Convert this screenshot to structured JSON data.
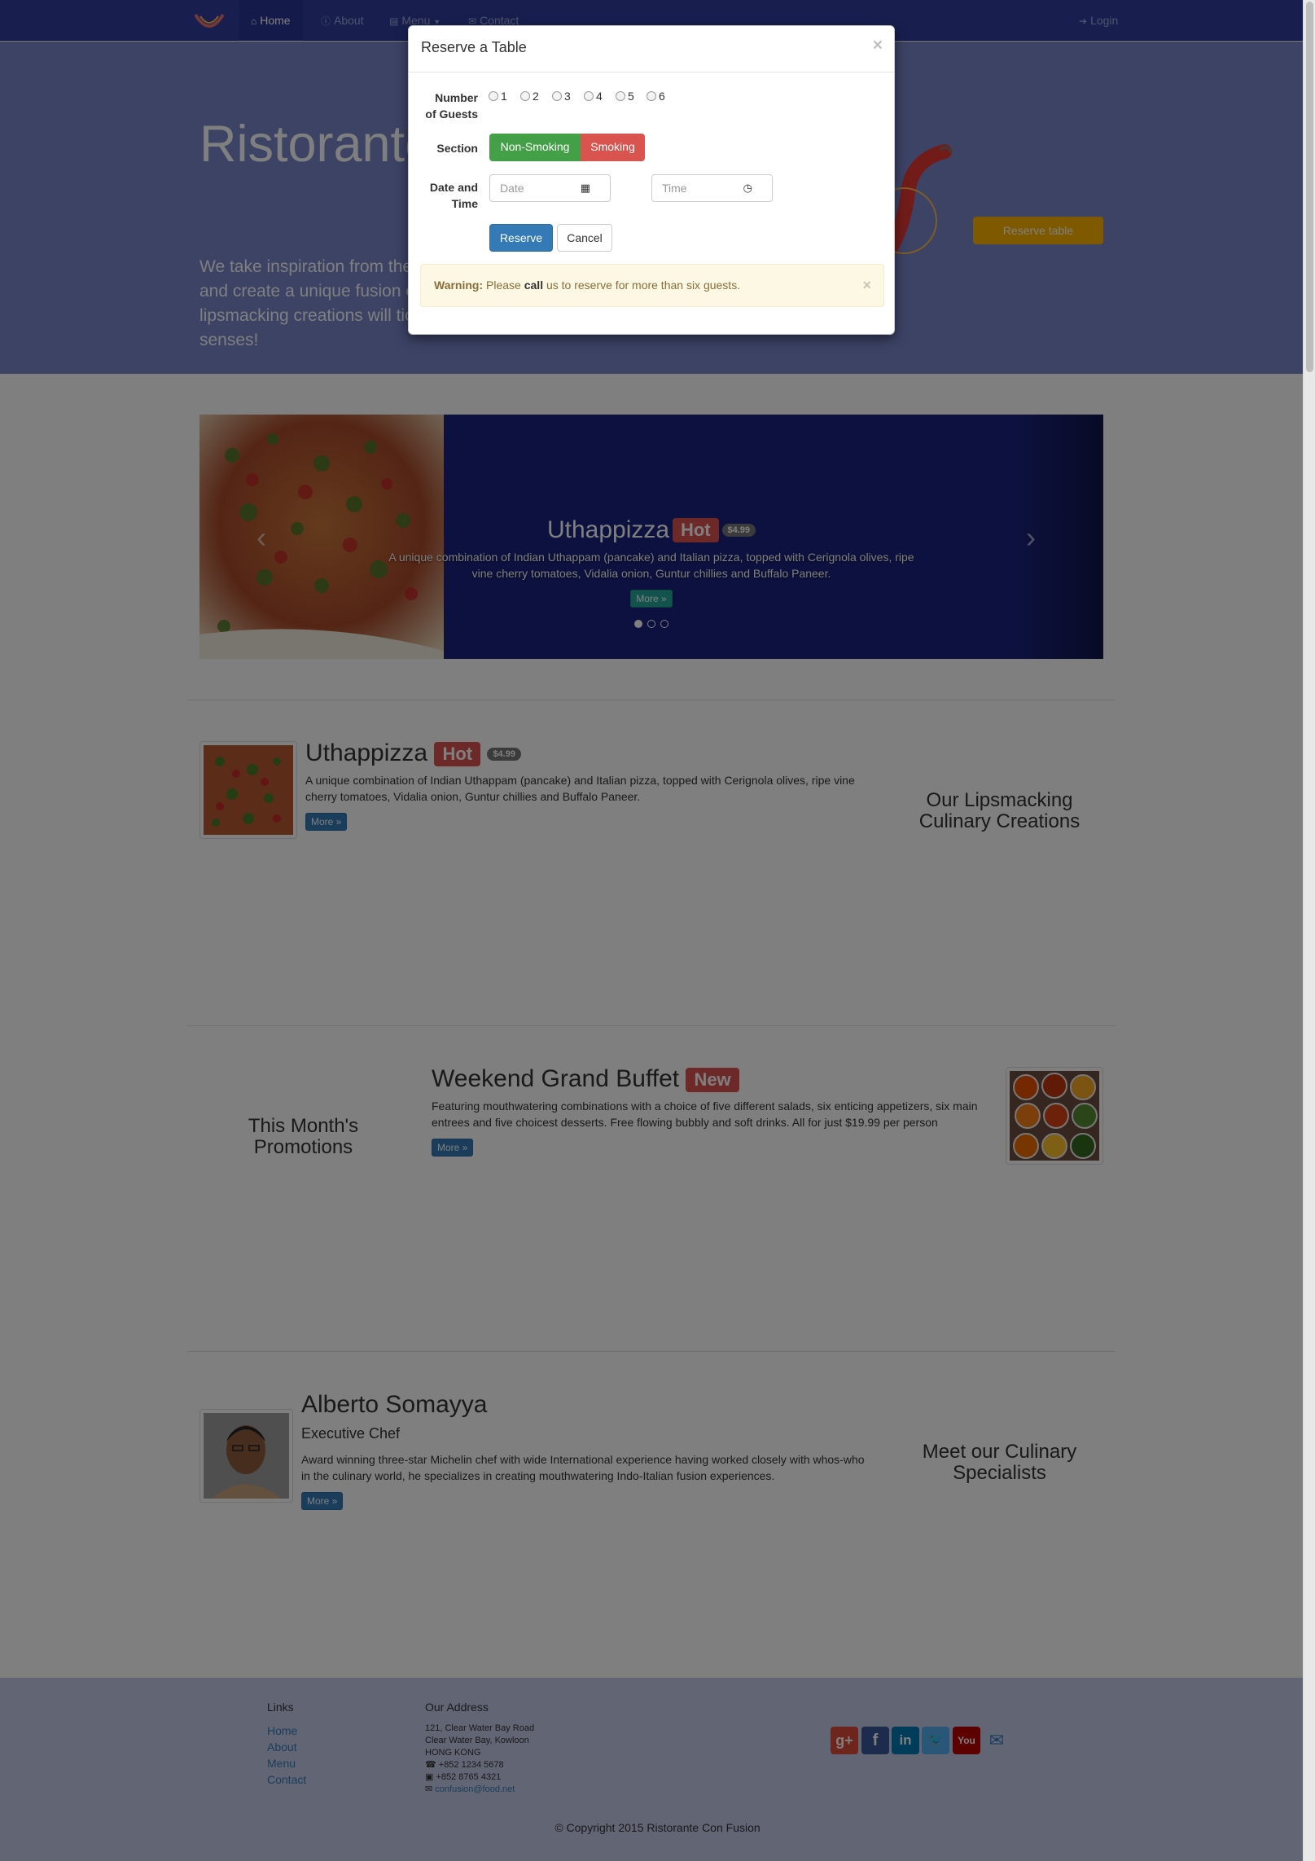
{
  "nav": {
    "items": [
      {
        "icon": "home-icon",
        "label": "Home"
      },
      {
        "icon": "info-icon",
        "label": "About"
      },
      {
        "icon": "list-icon",
        "label": "Menu"
      },
      {
        "icon": "envelope-icon",
        "label": "Contact"
      }
    ],
    "login": "Login"
  },
  "jumbotron": {
    "title": "Ristorante con Fusion",
    "text": "We take inspiration from the World's best cuisines, and create a unique fusion experience. Our lipsmacking creations will tickle your culinary senses!",
    "reserve_button": "Reserve table"
  },
  "carousel": {
    "title": "Uthappizza",
    "label": "Hot",
    "price": "$4.99",
    "description": "A unique combination of Indian Uthappam (pancake) and Italian pizza, topped with Cerignola olives, ripe vine cherry tomatoes, Vidalia onion, Guntur chillies and Buffalo Paneer.",
    "more": "More »",
    "slides": 3,
    "active_slide": 1
  },
  "dish": {
    "title": "Uthappizza",
    "label": "Hot",
    "price": "$4.99",
    "description": "A unique combination of Indian Uthappam (pancake) and Italian pizza, topped with Cerignola olives, ripe vine cherry tomatoes, Vidalia onion, Guntur chillies and Buffalo Paneer.",
    "more": "More »",
    "side_title_1": "Our Lipsmacking",
    "side_title_2": "Culinary Creations"
  },
  "promotion": {
    "title": "Weekend Grand Buffet",
    "label": "New",
    "description": "Featuring mouthwatering combinations with a choice of five different salads, six enticing appetizers, six main entrees and five choicest desserts. Free flowing bubbly and soft drinks. All for just $19.99 per person",
    "more": "More »",
    "side_title_1": "This Month's",
    "side_title_2": "Promotions"
  },
  "leader": {
    "name": "Alberto Somayya",
    "role": "Executive Chef",
    "description": "Award winning three-star Michelin chef with wide International experience having worked closely with whos-who in the culinary world, he specializes in creating mouthwatering Indo-Italian fusion experiences.",
    "more": "More »",
    "side_title_1": "Meet our Culinary",
    "side_title_2": "Specialists"
  },
  "footer": {
    "links_heading": "Links",
    "links": [
      "Home",
      "About",
      "Menu",
      "Contact"
    ],
    "address_heading": "Our Address",
    "address": [
      "121, Clear Water Bay Road",
      "Clear Water Bay, Kowloon",
      "HONG KONG"
    ],
    "phone": "+852 1234 5678",
    "fax": "+852 8765 4321",
    "email": "confusion@food.net",
    "social": [
      "google-plus",
      "facebook",
      "linkedin",
      "twitter",
      "youtube",
      "mail"
    ],
    "copyright": "© Copyright 2015 Ristorante Con Fusion"
  },
  "modal": {
    "title": "Reserve a Table",
    "guests_label_1": "Number",
    "guests_label_2": "of Guests",
    "guests_options": [
      "1",
      "2",
      "3",
      "4",
      "5",
      "6"
    ],
    "section_label": "Section",
    "section_options": [
      "Non-Smoking",
      "Smoking"
    ],
    "datetime_label_1": "Date and",
    "datetime_label_2": "Time",
    "date_placeholder": "Date",
    "time_placeholder": "Time",
    "reserve_button": "Reserve",
    "cancel_button": "Cancel",
    "warning_strong": "Warning:",
    "warning_pre": "Please",
    "warning_bold": "call",
    "warning_post": "us to reserve for more than six guests."
  },
  "colors": {
    "navbar": "#303f9f",
    "jumbotron": "#7986cb",
    "footer": "#c5cae9",
    "success": "#43a047",
    "danger": "#d9534f",
    "primary": "#337ab7",
    "accent": "#ffb300"
  }
}
